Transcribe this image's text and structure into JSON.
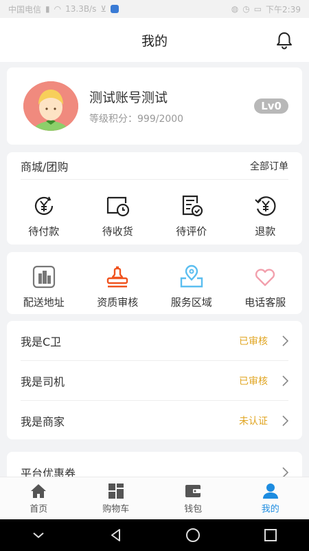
{
  "status_bar": {
    "carrier": "中国电信",
    "speed": "13.3B/s",
    "time": "下午2:39"
  },
  "header": {
    "title": "我的"
  },
  "profile": {
    "name": "测试账号测试",
    "level_text": "等级积分：999/2000",
    "level_badge": "Lv0"
  },
  "orders": {
    "title": "商城/团购",
    "all_orders": "全部订单",
    "items": [
      {
        "label": "待付款",
        "icon": "yen-pending-icon"
      },
      {
        "label": "待收货",
        "icon": "truck-clock-icon"
      },
      {
        "label": "待评价",
        "icon": "review-check-icon"
      },
      {
        "label": "退款",
        "icon": "refund-icon"
      }
    ]
  },
  "services": {
    "items": [
      {
        "label": "配送地址",
        "icon": "building-icon"
      },
      {
        "label": "资质审核",
        "icon": "stamp-icon"
      },
      {
        "label": "服务区域",
        "icon": "location-map-icon"
      },
      {
        "label": "电话客服",
        "icon": "heart-icon"
      }
    ]
  },
  "roles": [
    {
      "label": "我是C卫",
      "status": "已审核"
    },
    {
      "label": "我是司机",
      "status": "已审核"
    },
    {
      "label": "我是商家",
      "status": "未认证"
    }
  ],
  "coupon": {
    "label": "平台优惠券"
  },
  "tabbar": {
    "items": [
      {
        "label": "首页",
        "icon": "home-icon"
      },
      {
        "label": "购物车",
        "icon": "grid-icon"
      },
      {
        "label": "钱包",
        "icon": "wallet-icon"
      },
      {
        "label": "我的",
        "icon": "user-icon",
        "active": true
      }
    ]
  },
  "colors": {
    "status_accent": "#e0a522",
    "tab_active": "#1d8ce0",
    "stamp": "#f0531f",
    "location": "#5bbef0",
    "heart": "#f2a0ad",
    "avatar_bg": "#f08a7e"
  }
}
